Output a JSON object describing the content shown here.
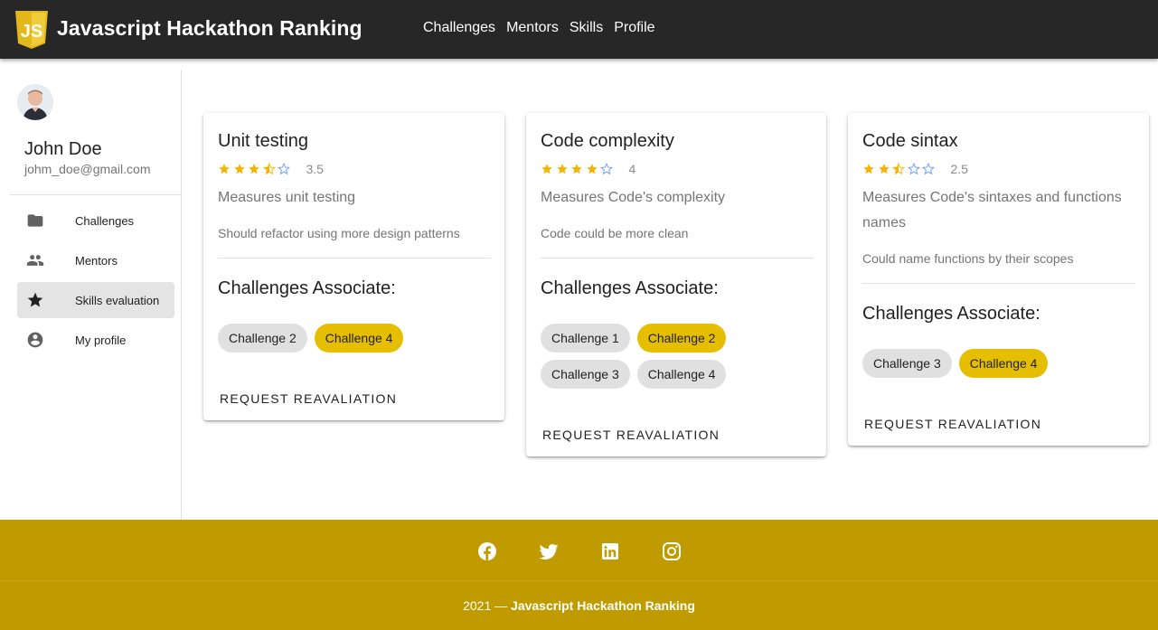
{
  "appbar": {
    "logo_text": "JS",
    "title": "Javascript Hackathon Ranking",
    "nav": [
      "Challenges",
      "Mentors",
      "Skills",
      "Profile"
    ]
  },
  "sidebar": {
    "user": {
      "name": "John Doe",
      "email": "johm_doe@gmail.com"
    },
    "items": [
      {
        "label": "Challenges",
        "icon": "folder-icon",
        "active": false
      },
      {
        "label": "Mentors",
        "icon": "people-icon",
        "active": false
      },
      {
        "label": "Skills evaluation",
        "icon": "star-icon",
        "active": true
      },
      {
        "label": "My profile",
        "icon": "account-circle-icon",
        "active": false
      }
    ]
  },
  "colors": {
    "appbar": "#272727",
    "footer": "#bf9b00",
    "chip_gold": "#e6be00",
    "star": "#f5b400",
    "star_empty": "#6b9cf5"
  },
  "cards": [
    {
      "title": "Unit testing",
      "rating": 3.5,
      "rating_text": "3.5",
      "subtitle": "Measures unit testing",
      "note": "Should refactor using more design patterns",
      "section_title": "Challenges Associate:",
      "chips": [
        {
          "label": "Challenge 2",
          "highlight": false
        },
        {
          "label": "Challenge 4",
          "highlight": true
        }
      ],
      "action": "REQUEST REAVALIATION"
    },
    {
      "title": "Code complexity",
      "rating": 4,
      "rating_text": "4",
      "subtitle": "Measures Code's complexity",
      "note": "Code could be more clean",
      "section_title": "Challenges Associate:",
      "chips": [
        {
          "label": "Challenge 1",
          "highlight": false
        },
        {
          "label": "Challenge 2",
          "highlight": true
        },
        {
          "label": "Challenge 3",
          "highlight": false
        },
        {
          "label": "Challenge 4",
          "highlight": false
        }
      ],
      "action": "REQUEST REAVALIATION"
    },
    {
      "title": "Code sintax",
      "rating": 2.5,
      "rating_text": "2.5",
      "subtitle": "Measures Code's sintaxes and functions names",
      "note": "Could name functions by their scopes",
      "section_title": "Challenges Associate:",
      "chips": [
        {
          "label": "Challenge 3",
          "highlight": false
        },
        {
          "label": "Challenge 4",
          "highlight": true
        }
      ],
      "action": "REQUEST REAVALIATION"
    }
  ],
  "footer": {
    "social": [
      "facebook-icon",
      "twitter-icon",
      "linkedin-icon",
      "instagram-icon"
    ],
    "year": "2021",
    "separator": "—",
    "brand": "Javascript Hackathon Ranking"
  }
}
